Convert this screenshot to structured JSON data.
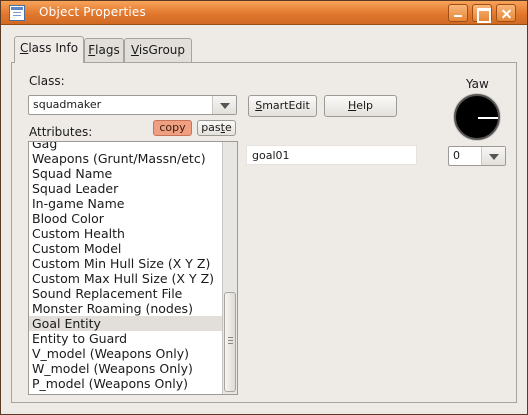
{
  "window": {
    "title": "Object Properties",
    "title_icon": "table-icon"
  },
  "tabs": [
    {
      "label_prefix": "",
      "label_mnemonic": "C",
      "label_rest": "lass Info",
      "active": true
    },
    {
      "label_prefix": "",
      "label_mnemonic": "F",
      "label_rest": "lags",
      "active": false
    },
    {
      "label_prefix": "",
      "label_mnemonic": "V",
      "label_rest": "isGroup",
      "active": false
    }
  ],
  "class_section": {
    "label": "Class:",
    "selected": "squadmaker"
  },
  "buttons": {
    "smartedit_mnemonic": "S",
    "smartedit_rest": "martEdit",
    "help_mnemonic": "H",
    "help_rest": "elp",
    "copy": "copy",
    "paste_prefix": "pas",
    "paste_mnemonic": "t",
    "paste_rest": "e"
  },
  "attributes": {
    "label": "Attributes:",
    "items": [
      "Gag",
      "Weapons (Grunt/Massn/etc)",
      "Squad Name",
      "Squad Leader",
      "In-game Name",
      "Blood Color",
      "Custom Health",
      "Custom Model",
      "Custom Min Hull Size (X Y Z)",
      "Custom Max Hull Size (X Y Z)",
      "Sound Replacement File",
      "Monster Roaming (nodes)",
      "Goal Entity",
      "Entity to Guard",
      "V_model (Weapons Only)",
      "W_model (Weapons Only)",
      "P_model (Weapons Only)"
    ],
    "selected_index": 12
  },
  "value_field": {
    "value": "goal01"
  },
  "yaw": {
    "label": "Yaw",
    "value": "0",
    "angle_degrees": 0
  },
  "colors": {
    "titlebar": "#e2782e",
    "copy_button": "#f0a080",
    "window_bg": "#eeebe7"
  }
}
